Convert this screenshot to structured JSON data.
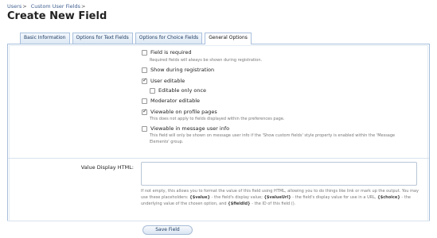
{
  "breadcrumb": {
    "items": [
      "Users",
      "Custom User Fields"
    ],
    "separator": ">"
  },
  "page_title": "Create New Field",
  "tabs": [
    {
      "label": "Basic Information",
      "active": false
    },
    {
      "label": "Options for Text Fields",
      "active": false
    },
    {
      "label": "Options for Choice Fields",
      "active": false
    },
    {
      "label": "General Options",
      "active": true
    }
  ],
  "options": {
    "required": {
      "label": "Field is required",
      "checked": false,
      "hint": "Required fields will always be shown during registration."
    },
    "show_registration": {
      "label": "Show during registration",
      "checked": false
    },
    "user_editable": {
      "label": "User editable",
      "checked": true
    },
    "editable_once": {
      "label": "Editable only once",
      "checked": false
    },
    "moderator_editable": {
      "label": "Moderator editable",
      "checked": false
    },
    "viewable_profile": {
      "label": "Viewable on profile pages",
      "checked": true,
      "hint": "This does not apply to fields displayed within the preferences page."
    },
    "viewable_message": {
      "label": "Viewable in message user info",
      "checked": false,
      "hint_line1": "This field will only be shown on message user info if the 'Show custom fields' style property is enabled within the 'Message",
      "hint_line2": "Elements' group."
    }
  },
  "value_display": {
    "label": "Value Display HTML:",
    "value": "",
    "explain_1": "If not empty, this allows you to format the value of this field using HTML, allowing you to do things like link or mark up the output. You may use these placeholders: ",
    "ph_value": "{$value}",
    "explain_2": " - the field's display value; ",
    "ph_valueurl": "{$valueUrl}",
    "explain_3": " - the field's display value for use in a URL, ",
    "ph_choice": "{$choice}",
    "explain_4": " - the underlying value of the chosen option, and ",
    "ph_fieldid": "{$fieldId}",
    "explain_5": " - the ID of this field ()."
  },
  "save_button": "Save Field"
}
